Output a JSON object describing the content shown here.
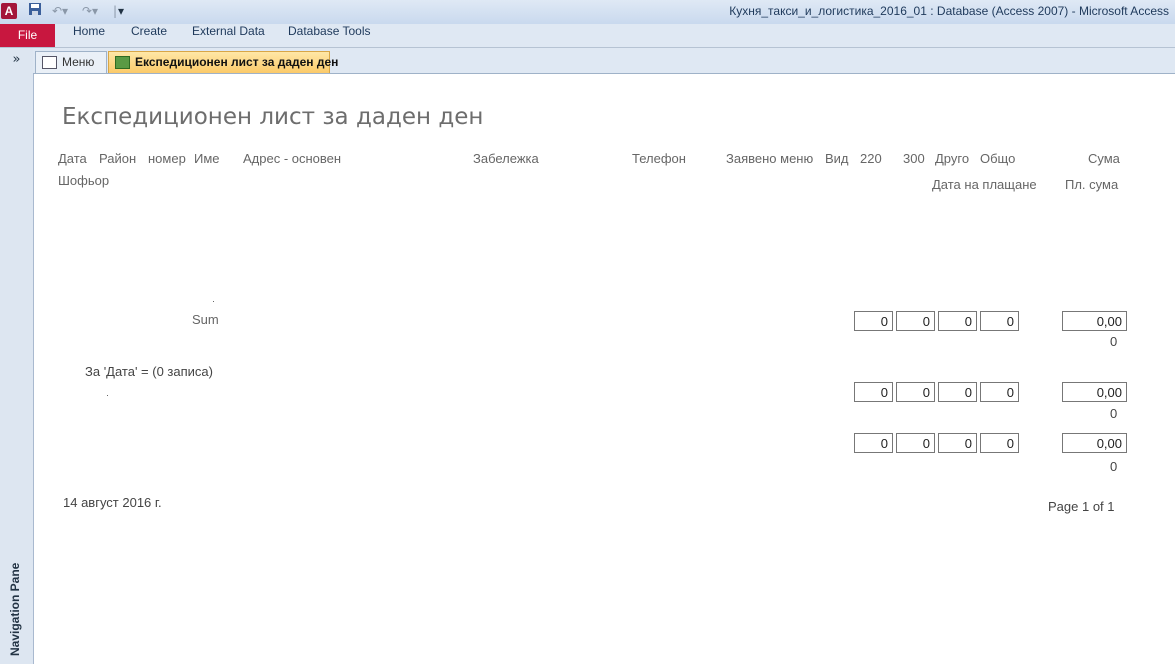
{
  "titlebar": {
    "app_icon": "A",
    "title": "Кухня_такси_и_логистика_2016_01 : Database (Access 2007)  -  Microsoft Access"
  },
  "ribbon": {
    "file": "File",
    "tabs": [
      "Home",
      "Create",
      "External Data",
      "Database Tools"
    ]
  },
  "nav": {
    "toggle": "»",
    "label": "Navigation Pane"
  },
  "doctabs": [
    {
      "label": "Меню"
    },
    {
      "label": "Експедиционен лист за даден ден"
    }
  ],
  "report": {
    "title": "Експедиционен лист за даден ден",
    "headers": {
      "date": "Дата",
      "district": "Район",
      "number": "номер",
      "name": "Име",
      "address": "Адрес - основен",
      "note": "Забележка",
      "phone": "Телефон",
      "menu": "Заявено меню",
      "type": "Вид",
      "c220": "220",
      "c300": "300",
      "other": "Друго",
      "total": "Общо",
      "sum": "Сума",
      "driver": "Шофьор",
      "pay_date": "Дата на плащане",
      "paid_sum": "Пл. сума"
    },
    "sum_label": "Sum",
    "group_label": "За 'Дата' =   (0 записа)",
    "rows": [
      {
        "v220": "0",
        "v300": "0",
        "other": "0",
        "total": "0",
        "sum": "0,00",
        "count": "0"
      },
      {
        "v220": "0",
        "v300": "0",
        "other": "0",
        "total": "0",
        "sum": "0,00",
        "count": "0"
      },
      {
        "v220": "0",
        "v300": "0",
        "other": "0",
        "total": "0",
        "sum": "0,00",
        "count": "0"
      }
    ],
    "footer_date": "14 август 2016 г.",
    "page_info": "Page 1 of 1"
  }
}
